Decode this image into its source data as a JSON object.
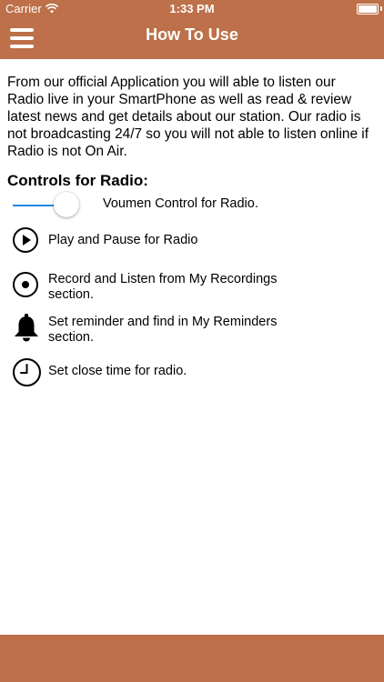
{
  "status_bar": {
    "carrier": "Carrier",
    "time": "1:33 PM"
  },
  "nav": {
    "title": "How To Use",
    "menu_icon": "hamburger-menu-icon"
  },
  "intro_text": "From our official Application you will able to listen our Radio live in your SmartPhone as well as read & review latest news and  get details about our station. Our radio is not broadcasting 24/7 so you will not able to listen online if Radio is not On Air.",
  "controls": {
    "title": "Controls for Radio:",
    "volume": {
      "label": "Voumen Control for Radio.",
      "level": 0.55
    },
    "play": {
      "label": "Play and Pause for Radio",
      "icon": "play-icon"
    },
    "record": {
      "label": "Record and Listen from My Recordings section.",
      "icon": "record-icon"
    },
    "reminder": {
      "label": "Set reminder and find in My Reminders section.",
      "icon": "bell-icon"
    },
    "timer": {
      "label": "Set close time for radio.",
      "icon": "clock-icon"
    }
  },
  "colors": {
    "brand": "#bd7049",
    "slider_accent": "#1e88e5"
  }
}
